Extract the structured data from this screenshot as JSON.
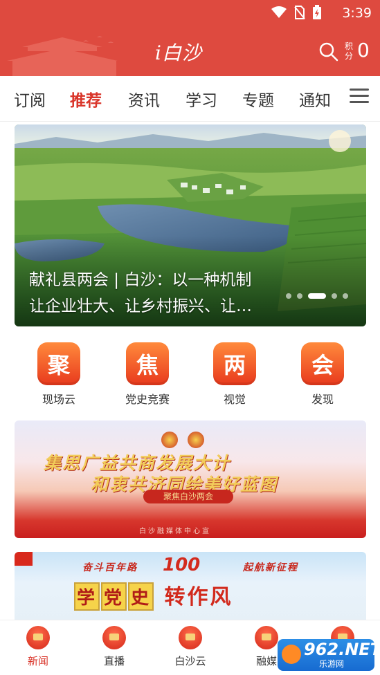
{
  "status_bar": {
    "time": "3:39"
  },
  "header": {
    "logo_text": "i白沙",
    "points_label": "积分",
    "points_value": "0"
  },
  "tabs": [
    {
      "label": "订阅"
    },
    {
      "label": "推荐",
      "active": true
    },
    {
      "label": "资讯"
    },
    {
      "label": "学习"
    },
    {
      "label": "专题"
    },
    {
      "label": "通知"
    }
  ],
  "banner": {
    "caption_line1": "献礼县两会 | 白沙：以一种机制",
    "caption_line2": "让企业壮大、让乡村振兴、让…",
    "slide_count": 5,
    "active_slide": 3
  },
  "quick_entries": [
    {
      "glyph": "聚",
      "label": "现场云"
    },
    {
      "glyph": "焦",
      "label": "党史竞赛"
    },
    {
      "glyph": "两",
      "label": "视觉"
    },
    {
      "glyph": "会",
      "label": "发现"
    }
  ],
  "promo1": {
    "line1": "集思广益共商发展大计",
    "line2": "和衷共济同绘美好蓝图",
    "tag": "聚焦白沙两会",
    "footer": "白沙融媒体中心宣"
  },
  "promo2": {
    "top_left": "奋斗百年路",
    "badge": "100",
    "top_right": "起航新征程",
    "big_words": [
      "学",
      "党",
      "史"
    ],
    "big_tail": "转作风"
  },
  "bottom_nav": [
    {
      "label": "新闻",
      "active": true
    },
    {
      "label": "直播"
    },
    {
      "label": "白沙云"
    },
    {
      "label": "融媒"
    },
    {
      "label": ""
    }
  ],
  "watermark": {
    "text": "962.NET",
    "sub": "乐游网"
  },
  "colors": {
    "header": "#de4a3f",
    "accent": "#d9352a"
  }
}
